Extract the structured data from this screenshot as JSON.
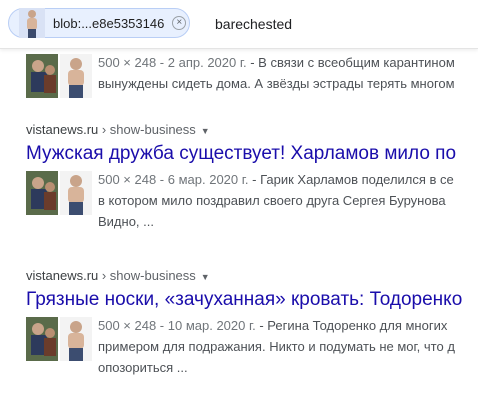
{
  "search_bar": {
    "image_chip_label": "blob:...e8e5353146",
    "close_glyph": "×",
    "query": "barechested"
  },
  "results": [
    {
      "meta": "500 × 248 - 2 апр. 2020 г.",
      "snippet_line1": " - В связи с всеобщим карантином",
      "snippet_line2": "вынуждены сидеть дома. А звёзды эстрады терять многом"
    },
    {
      "site": "vistanews.ru",
      "path": " › show-business",
      "title": "Мужская дружба существует! Харламов мило по",
      "meta": "500 × 248 - 6 мар. 2020 г.",
      "snippet_line1": " - Гарик Харламов поделился в се",
      "snippet_line2": "в котором мило поздравил своего друга Сергея Бурунова ",
      "snippet_line3": "Видно, ..."
    },
    {
      "site": "vistanews.ru",
      "path": " › show-business",
      "title": "Грязные носки, «зачуханная» кровать: Тодоренко",
      "meta": "500 × 248 - 10 мар. 2020 г.",
      "snippet_line1": " - Регина Тодоренко для многих ",
      "snippet_line2": "примером для подражания. Никто и подумать не мог, что д",
      "snippet_line3": "опозориться ..."
    }
  ],
  "colors": {
    "link": "#1a0dab",
    "chip_bg": "#e8f0fe",
    "snippet": "#4d5156"
  },
  "icons": {
    "caret": "dropdown-caret-icon",
    "close": "close-icon"
  }
}
